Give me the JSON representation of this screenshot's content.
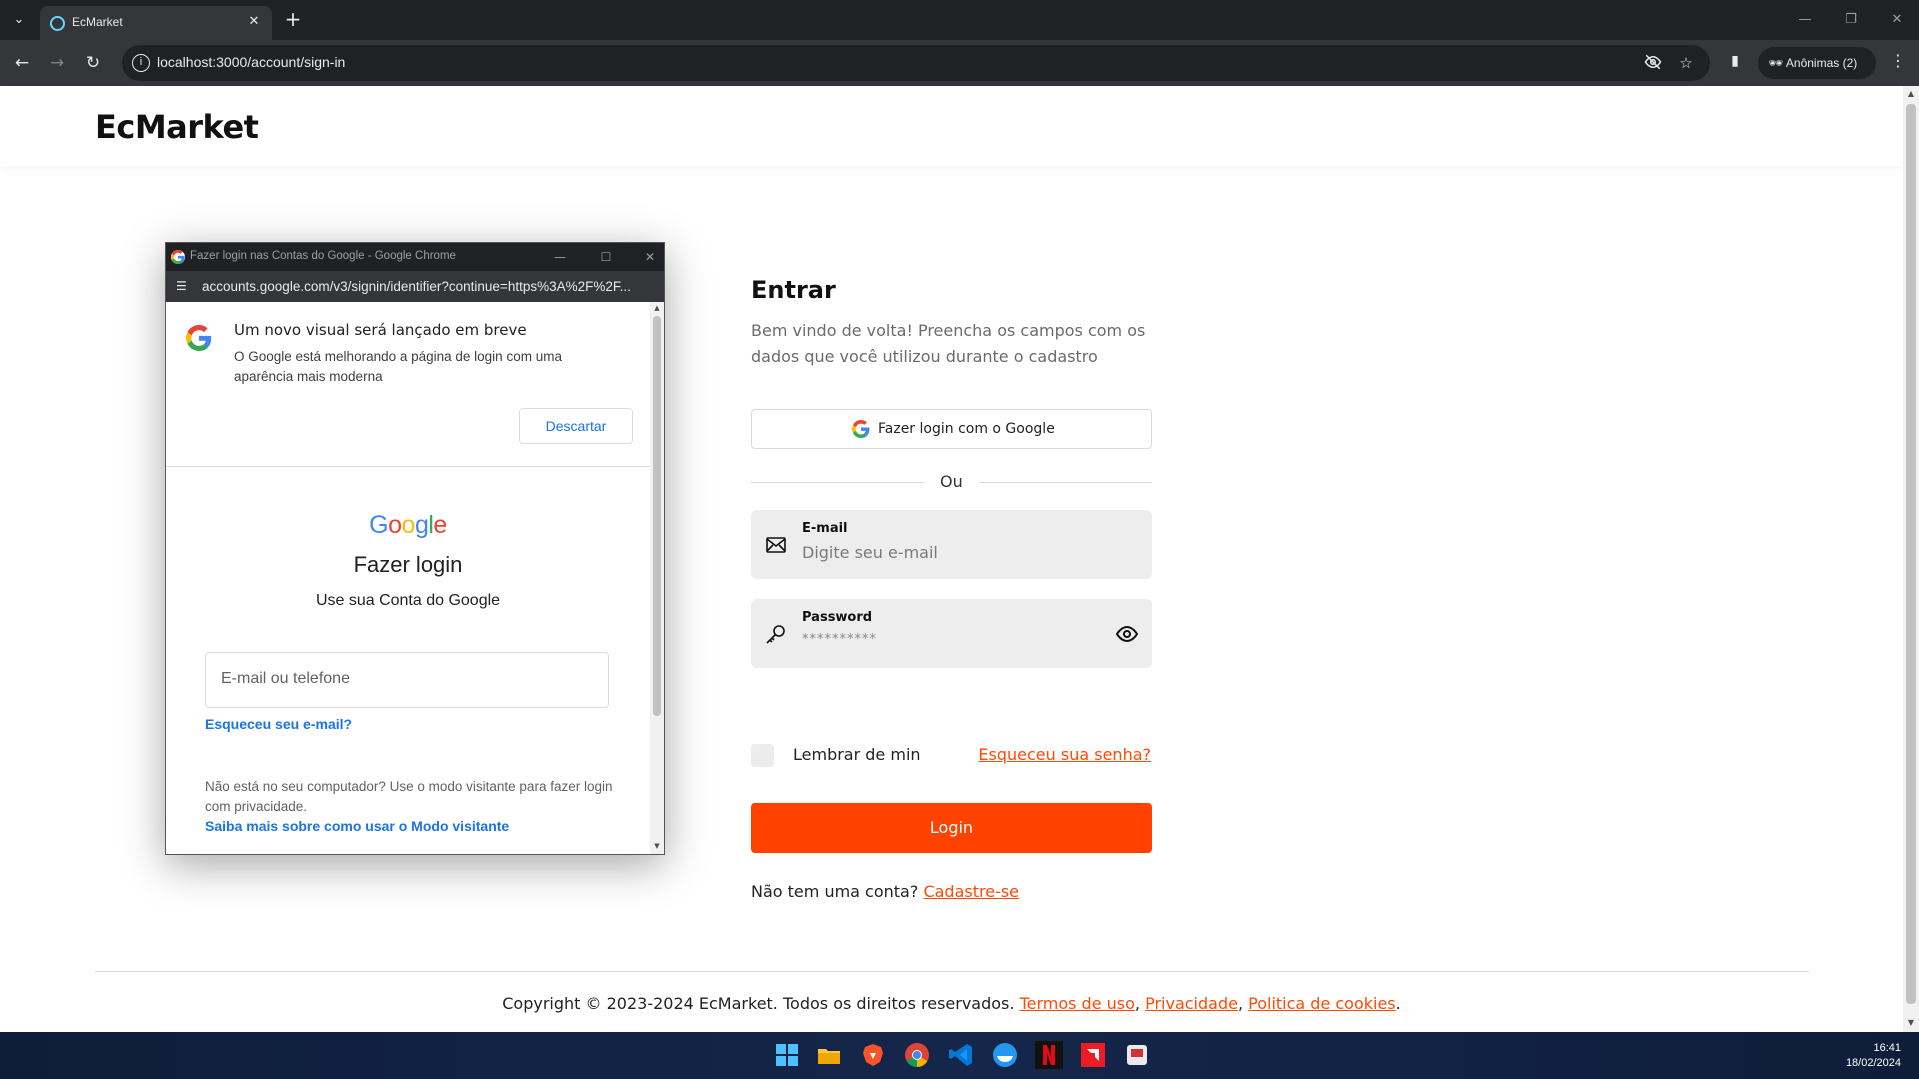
{
  "browser": {
    "tab_title": "EcMarket",
    "new_tab": "+",
    "url": "localhost:3000/account/sign-in",
    "incognito_label": "Anônimas (2)"
  },
  "site": {
    "logo": "EcMarket"
  },
  "signin": {
    "title": "Entrar",
    "subtitle": "Bem vindo de volta! Preencha os campos com os dados que você utilizou durante o cadastro",
    "google_button": "Fazer login com o Google",
    "divider": "Ou",
    "email_label": "E-mail",
    "email_placeholder": "Digite seu e-mail",
    "password_label": "Password",
    "password_value": "**********",
    "remember": "Lembrar de min",
    "forgot": "Esqueceu sua senha?",
    "login_button": "Login",
    "no_account": "Não tem uma conta?",
    "signup_link": "Cadastre-se"
  },
  "footer": {
    "copyright": "Copyright © 2023-2024 EcMarket. Todos os direitos reservados.",
    "terms": "Termos de uso",
    "privacy": "Privacidade",
    "cookies": "Politica de cookies"
  },
  "popup": {
    "window_title": "Fazer login nas Contas do Google - Google Chrome",
    "url": "accounts.google.com/v3/signin/identifier?continue=https%3A%2F%2F...",
    "notice_title": "Um novo visual será lançado em breve",
    "notice_text": "O Google está melhorando a página de login com uma aparência mais moderna",
    "dismiss_button": "Descartar",
    "heading": "Fazer login",
    "subheading": "Use sua Conta do Google",
    "email_placeholder": "E-mail ou telefone",
    "forgot_email": "Esqueceu seu e-mail?",
    "guest_text": "Não está no seu computador? Use o modo visitante para fazer login com privacidade.",
    "guest_link": "Saiba mais sobre como usar o Modo visitante"
  },
  "taskbar": {
    "time": "16:41",
    "date": "18/02/2024"
  },
  "colors": {
    "accent": "#ff4200",
    "link": "#ff4a06",
    "google_blue": "#1a73e8"
  }
}
